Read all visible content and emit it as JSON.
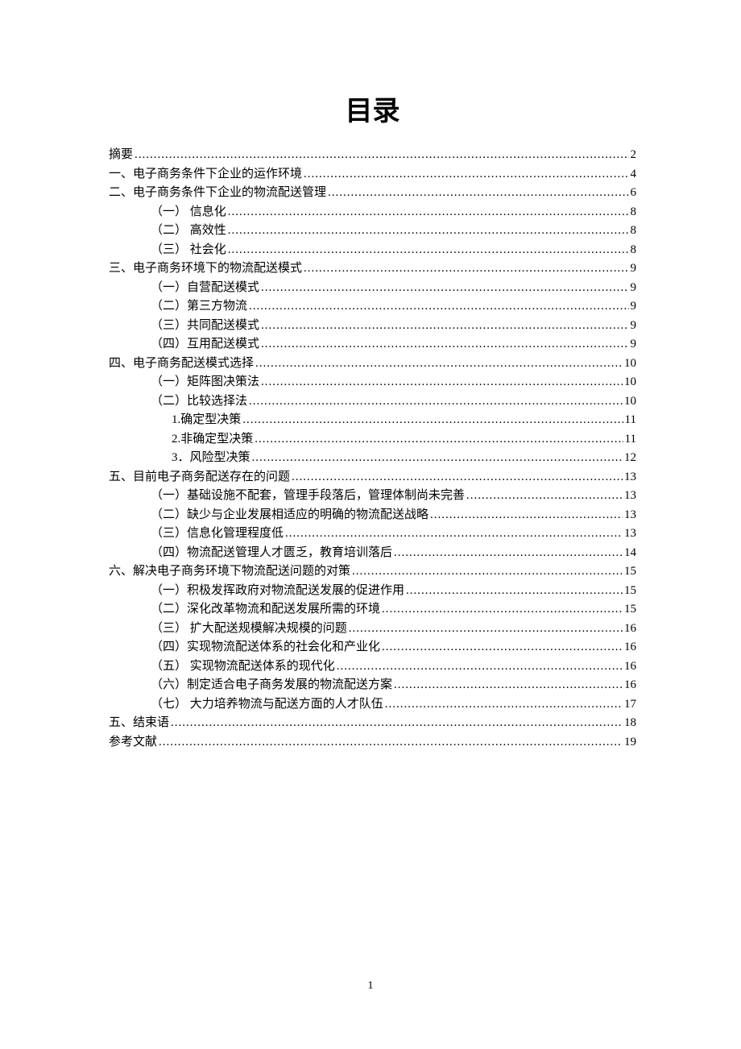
{
  "title": "目录",
  "page_number": "1",
  "toc": [
    {
      "level": 0,
      "label": "摘要",
      "page": "2"
    },
    {
      "level": 0,
      "label": "一、电子商务条件下企业的运作环境",
      "page": "4"
    },
    {
      "level": 0,
      "label": "二、电子商务条件下企业的物流配送管理",
      "page": "6"
    },
    {
      "level": 1,
      "label": "（一） 信息化",
      "page": "8"
    },
    {
      "level": 1,
      "label": "（二） 高效性",
      "page": "8"
    },
    {
      "level": 1,
      "label": "（三） 社会化",
      "page": "8"
    },
    {
      "level": 0,
      "label": "三、电子商务环境下的物流配送模式",
      "page": "9"
    },
    {
      "level": 1,
      "label": "（一）自营配送模式",
      "page": "9"
    },
    {
      "level": 1,
      "label": "（二）第三方物流",
      "page": "9"
    },
    {
      "level": 1,
      "label": "（三）共同配送模式",
      "page": "9"
    },
    {
      "level": 1,
      "label": "（四）互用配送模式",
      "page": "9"
    },
    {
      "level": 0,
      "label": "四、电子商务配送模式选择",
      "page": "10"
    },
    {
      "level": 1,
      "label": "（一）矩阵图决策法",
      "page": "10"
    },
    {
      "level": 1,
      "label": "（二）比较选择法",
      "page": "10"
    },
    {
      "level": 2,
      "label": "1.确定型决策",
      "page": "11"
    },
    {
      "level": 2,
      "label": "2.非确定型决策",
      "page": "11"
    },
    {
      "level": 2,
      "label": "3．风险型决策",
      "page": "12"
    },
    {
      "level": 0,
      "label": "五、目前电子商务配送存在的问题",
      "page": "13"
    },
    {
      "level": 1,
      "label": "（一）基础设施不配套，管理手段落后，管理体制尚未完善",
      "page": "13"
    },
    {
      "level": 1,
      "label": "（二）缺少与企业发展相适应的明确的物流配送战略",
      "page": "13"
    },
    {
      "level": 1,
      "label": "（三）信息化管理程度低",
      "page": "13"
    },
    {
      "level": 1,
      "label": "（四）物流配送管理人才匮乏，教育培训落后",
      "page": "14"
    },
    {
      "level": 0,
      "label": "六、解决电子商务环境下物流配送问题的对策",
      "page": "15"
    },
    {
      "level": 1,
      "label": "（一）积极发挥政府对物流配送发展的促进作用",
      "page": "15"
    },
    {
      "level": 1,
      "label": "（二）深化改革物流和配送发展所需的环境",
      "page": "15"
    },
    {
      "level": 1,
      "label": "（三） 扩大配送规模解决规模的问题",
      "page": "16"
    },
    {
      "level": 1,
      "label": "（四）实现物流配送体系的社会化和产业化",
      "page": "16"
    },
    {
      "level": 1,
      "label": "（五） 实现物流配送体系的现代化",
      "page": "16"
    },
    {
      "level": 1,
      "label": "（六）制定适合电子商务发展的物流配送方案",
      "page": "16"
    },
    {
      "level": 1,
      "label": "（七） 大力培养物流与配送方面的人才队伍",
      "page": "17"
    },
    {
      "level": 0,
      "label": "五、结束语",
      "page": "18"
    },
    {
      "level": 0,
      "label": "参考文献",
      "page": "19"
    }
  ]
}
